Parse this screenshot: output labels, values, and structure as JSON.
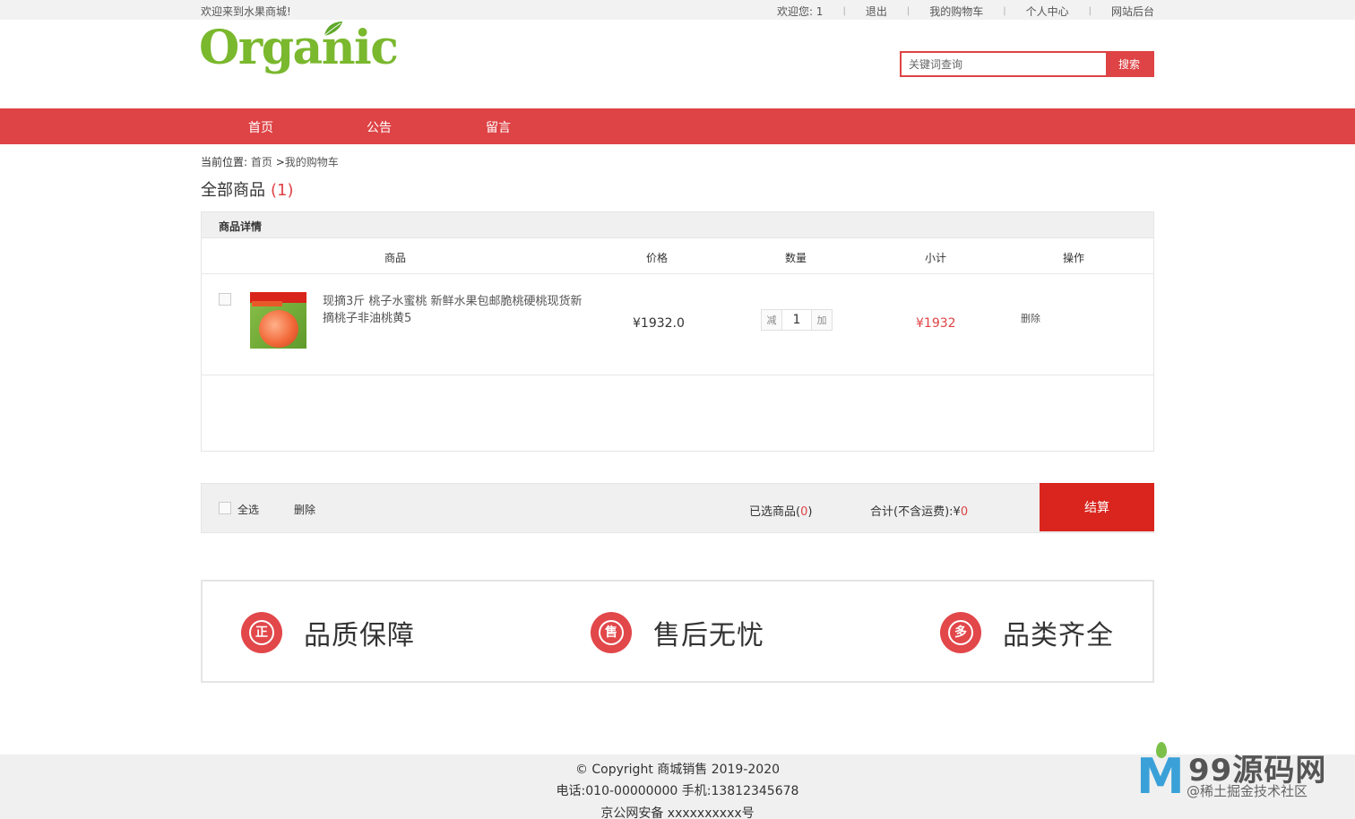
{
  "topbar": {
    "welcome": "欢迎来到水果商城!",
    "links": [
      {
        "label": "欢迎您:  1"
      },
      {
        "label": "退出"
      },
      {
        "label": "我的购物车"
      },
      {
        "label": "个人中心"
      },
      {
        "label": "网站后台"
      }
    ]
  },
  "logo": {
    "text": "Organic"
  },
  "search": {
    "placeholder": "关键词查询",
    "button_label": "搜索"
  },
  "mainnav": {
    "items": [
      "首页",
      "公告",
      "留言"
    ]
  },
  "breadcrumb": {
    "prefix": "当前位置:",
    "home": "首页",
    "sep": ">",
    "current": "我的购物车"
  },
  "cart": {
    "title": "全部商品",
    "count": "(1)",
    "section_label": "商品详情",
    "columns": [
      "商品",
      "价格",
      "数量",
      "小计",
      "操作"
    ],
    "items": [
      {
        "name": "现摘3斤 桃子水蜜桃 新鲜水果包邮脆桃硬桃现货新摘桃子非油桃黄5",
        "price": "¥1932.0",
        "qty_minus": "减",
        "qty": "1",
        "qty_plus": "加",
        "subtotal": "¥1932",
        "delete": "删除"
      }
    ]
  },
  "cartfoot": {
    "select_all": "全选",
    "delete": "删除",
    "selected_label": "已选商品",
    "selected_count": "0",
    "total_label": "合计(不含运费):",
    "total_currency": "¥",
    "total_value": "0",
    "checkout": "结算"
  },
  "services": [
    {
      "icon": "正",
      "label": "品质保障"
    },
    {
      "icon": "售",
      "label": "售后无忧"
    },
    {
      "icon": "多",
      "label": "品类齐全"
    }
  ],
  "footer": {
    "copyright": "© Copyright 商城销售 2019-2020",
    "contact": "电话:010-00000000 手机:13812345678",
    "icp": "京公网安备 xxxxxxxxxx号"
  },
  "watermark": {
    "title": "99源码网",
    "subtitle": "@稀土掘金技术社区"
  },
  "colors": {
    "accent": "#de4345",
    "checkout": "#d9251d",
    "logo": "#7ab82e"
  }
}
